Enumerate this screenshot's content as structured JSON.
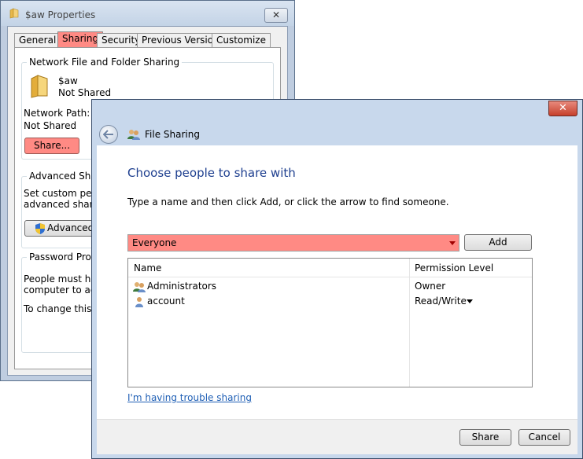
{
  "properties_window": {
    "title": "$aw Properties",
    "close_label": "✕",
    "tabs": [
      {
        "label": "General"
      },
      {
        "label": "Sharing"
      },
      {
        "label": "Security"
      },
      {
        "label": "Previous Versions"
      },
      {
        "label": "Customize"
      }
    ],
    "network_sharing": {
      "group_title": "Network File and Folder Sharing",
      "folder_name": "$aw",
      "folder_status": "Not Shared",
      "network_path_label": "Network Path:",
      "network_path_value": "Not Shared",
      "share_button": "Share..."
    },
    "advanced": {
      "group_title": "Advanced Sharin",
      "line1": "Set custom perm",
      "line2": "advanced sharin",
      "button": "Advanced"
    },
    "password": {
      "group_title": "Password Protec",
      "line1": "People must hav",
      "line2": "computer to acc",
      "line3": "To change this s"
    }
  },
  "file_sharing_window": {
    "close_label": "✕",
    "title": "File Sharing",
    "heading": "Choose people to share with",
    "instruction": "Type a name and then click Add, or click the arrow to find someone.",
    "name_input_value": "Everyone",
    "add_button": "Add",
    "columns": {
      "name": "Name",
      "permission": "Permission Level"
    },
    "rows": [
      {
        "name": "Administrators",
        "permission": "Owner"
      },
      {
        "name": "account",
        "permission": "Read/Write"
      }
    ],
    "trouble_link": "I'm having trouble sharing",
    "share_button": "Share",
    "cancel_button": "Cancel"
  },
  "colors": {
    "highlight": "#ff8a84",
    "heading_blue": "#1e3f8f",
    "link_blue": "#1f5fb5"
  }
}
